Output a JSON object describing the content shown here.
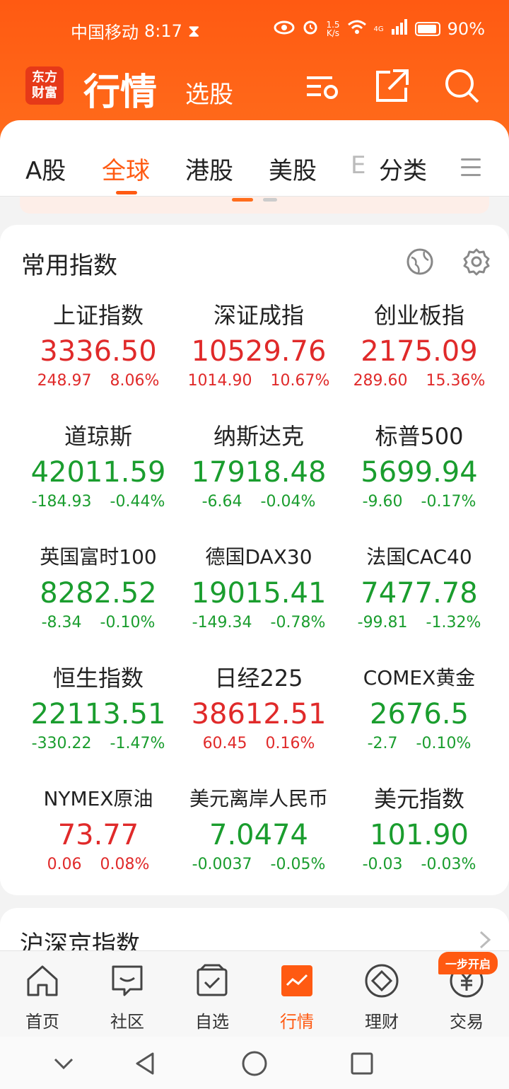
{
  "status": {
    "carrier": "中国移动",
    "time": "8:17",
    "net_speed_top": "1.5",
    "net_speed_bottom": "K/s",
    "signal_label": "4G",
    "battery": "90%"
  },
  "app": {
    "logo_line1": "东方",
    "logo_line2": "财富",
    "title": "行情",
    "subtitle": "选股"
  },
  "tabs": [
    "A股",
    "全球",
    "港股",
    "美股",
    "E",
    "分类"
  ],
  "section_title": "常用指数",
  "indices": [
    {
      "name": "上证指数",
      "price": "3336.50",
      "change": "248.97",
      "percent": "8.06%",
      "trend": "up"
    },
    {
      "name": "深证成指",
      "price": "10529.76",
      "change": "1014.90",
      "percent": "10.67%",
      "trend": "up"
    },
    {
      "name": "创业板指",
      "price": "2175.09",
      "change": "289.60",
      "percent": "15.36%",
      "trend": "up"
    },
    {
      "name": "道琼斯",
      "price": "42011.59",
      "change": "-184.93",
      "percent": "-0.44%",
      "trend": "down"
    },
    {
      "name": "纳斯达克",
      "price": "17918.48",
      "change": "-6.64",
      "percent": "-0.04%",
      "trend": "down"
    },
    {
      "name": "标普500",
      "price": "5699.94",
      "change": "-9.60",
      "percent": "-0.17%",
      "trend": "down"
    },
    {
      "name": "英国富时100",
      "price": "8282.52",
      "change": "-8.34",
      "percent": "-0.10%",
      "trend": "down"
    },
    {
      "name": "德国DAX30",
      "price": "19015.41",
      "change": "-149.34",
      "percent": "-0.78%",
      "trend": "down"
    },
    {
      "name": "法国CAC40",
      "price": "7477.78",
      "change": "-99.81",
      "percent": "-1.32%",
      "trend": "down"
    },
    {
      "name": "恒生指数",
      "price": "22113.51",
      "change": "-330.22",
      "percent": "-1.47%",
      "trend": "down"
    },
    {
      "name": "日经225",
      "price": "38612.51",
      "change": "60.45",
      "percent": "0.16%",
      "trend": "up"
    },
    {
      "name": "COMEX黄金",
      "price": "2676.5",
      "change": "-2.7",
      "percent": "-0.10%",
      "trend": "down"
    },
    {
      "name": "NYMEX原油",
      "price": "73.77",
      "change": "0.06",
      "percent": "0.08%",
      "trend": "up"
    },
    {
      "name": "美元离岸人民币",
      "price": "7.0474",
      "change": "-0.0037",
      "percent": "-0.05%",
      "trend": "down"
    },
    {
      "name": "美元指数",
      "price": "101.90",
      "change": "-0.03",
      "percent": "-0.03%",
      "trend": "down"
    }
  ],
  "next_section_title": "沪深京指数",
  "promo_badge": "一步开启",
  "bottom_nav": [
    "首页",
    "社区",
    "自选",
    "行情",
    "理财",
    "交易"
  ],
  "colors": {
    "accent": "#ff5a12",
    "up": "#e02a2a",
    "down": "#1a9d2e"
  }
}
